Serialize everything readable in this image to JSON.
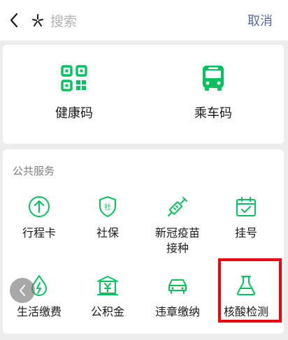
{
  "header": {
    "search_placeholder": "搜索",
    "cancel_label": "取消"
  },
  "top_card": {
    "items": [
      {
        "label": "健康码",
        "icon": "qr-code-icon"
      },
      {
        "label": "乘车码",
        "icon": "bus-icon"
      }
    ]
  },
  "services": {
    "title": "公共服务",
    "items": [
      {
        "label": "行程卡",
        "icon": "arrow-up-circle-icon"
      },
      {
        "label": "社保",
        "icon": "shield-she-icon"
      },
      {
        "label": "新冠疫苗",
        "label2": "接种",
        "icon": "syringe-icon"
      },
      {
        "label": "挂号",
        "icon": "calendar-check-icon"
      },
      {
        "label": "生活缴费",
        "icon": "water-drop-icon"
      },
      {
        "label": "公积金",
        "icon": "bank-yuan-icon"
      },
      {
        "label": "违章缴纳",
        "icon": "car-icon"
      },
      {
        "label": "核酸检测",
        "icon": "flask-icon"
      }
    ]
  },
  "colors": {
    "accent_green": "#07c160",
    "link_blue": "#576b95",
    "highlight_red": "#f0000e"
  }
}
